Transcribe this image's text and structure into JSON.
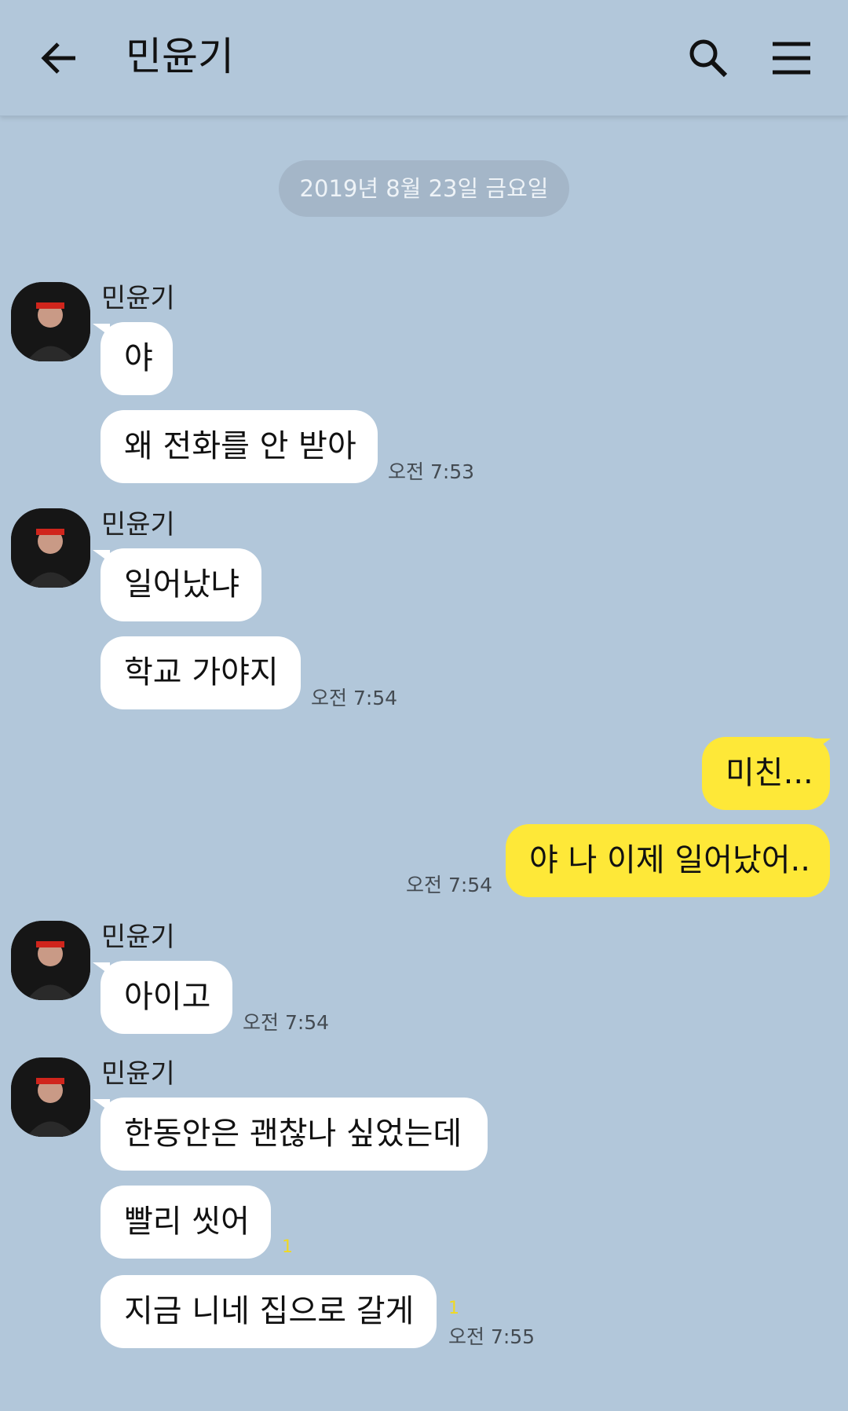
{
  "header": {
    "title": "민윤기",
    "back_icon": "arrow-left-icon",
    "search_icon": "search-icon",
    "menu_icon": "hamburger-menu-icon"
  },
  "date_divider": "2019년 8월 23일 금요일",
  "colors": {
    "background": "#b2c7da",
    "incoming_bubble": "#ffffff",
    "outgoing_bubble": "#fee838",
    "unread_count": "#f1d920"
  },
  "groups": [
    {
      "sender": "민윤기",
      "messages": [
        "야",
        "왜 전화를 안 받아"
      ],
      "time": "오전 7:53"
    },
    {
      "sender": "민윤기",
      "messages": [
        "일어났냐",
        "학교 가야지"
      ],
      "time": "오전 7:54"
    },
    {
      "sender": "me",
      "messages": [
        "미친...",
        "야 나 이제 일어났어.."
      ],
      "time": "오전 7:54"
    },
    {
      "sender": "민윤기",
      "messages": [
        "아이고"
      ],
      "time": "오전 7:54"
    },
    {
      "sender": "민윤기",
      "messages": [
        "한동안은 괜찮나 싶었는데",
        "빨리 씻어",
        "지금 니네 집으로 갈게"
      ],
      "unread": [
        "1",
        "1"
      ],
      "time": "오전 7:55"
    }
  ]
}
